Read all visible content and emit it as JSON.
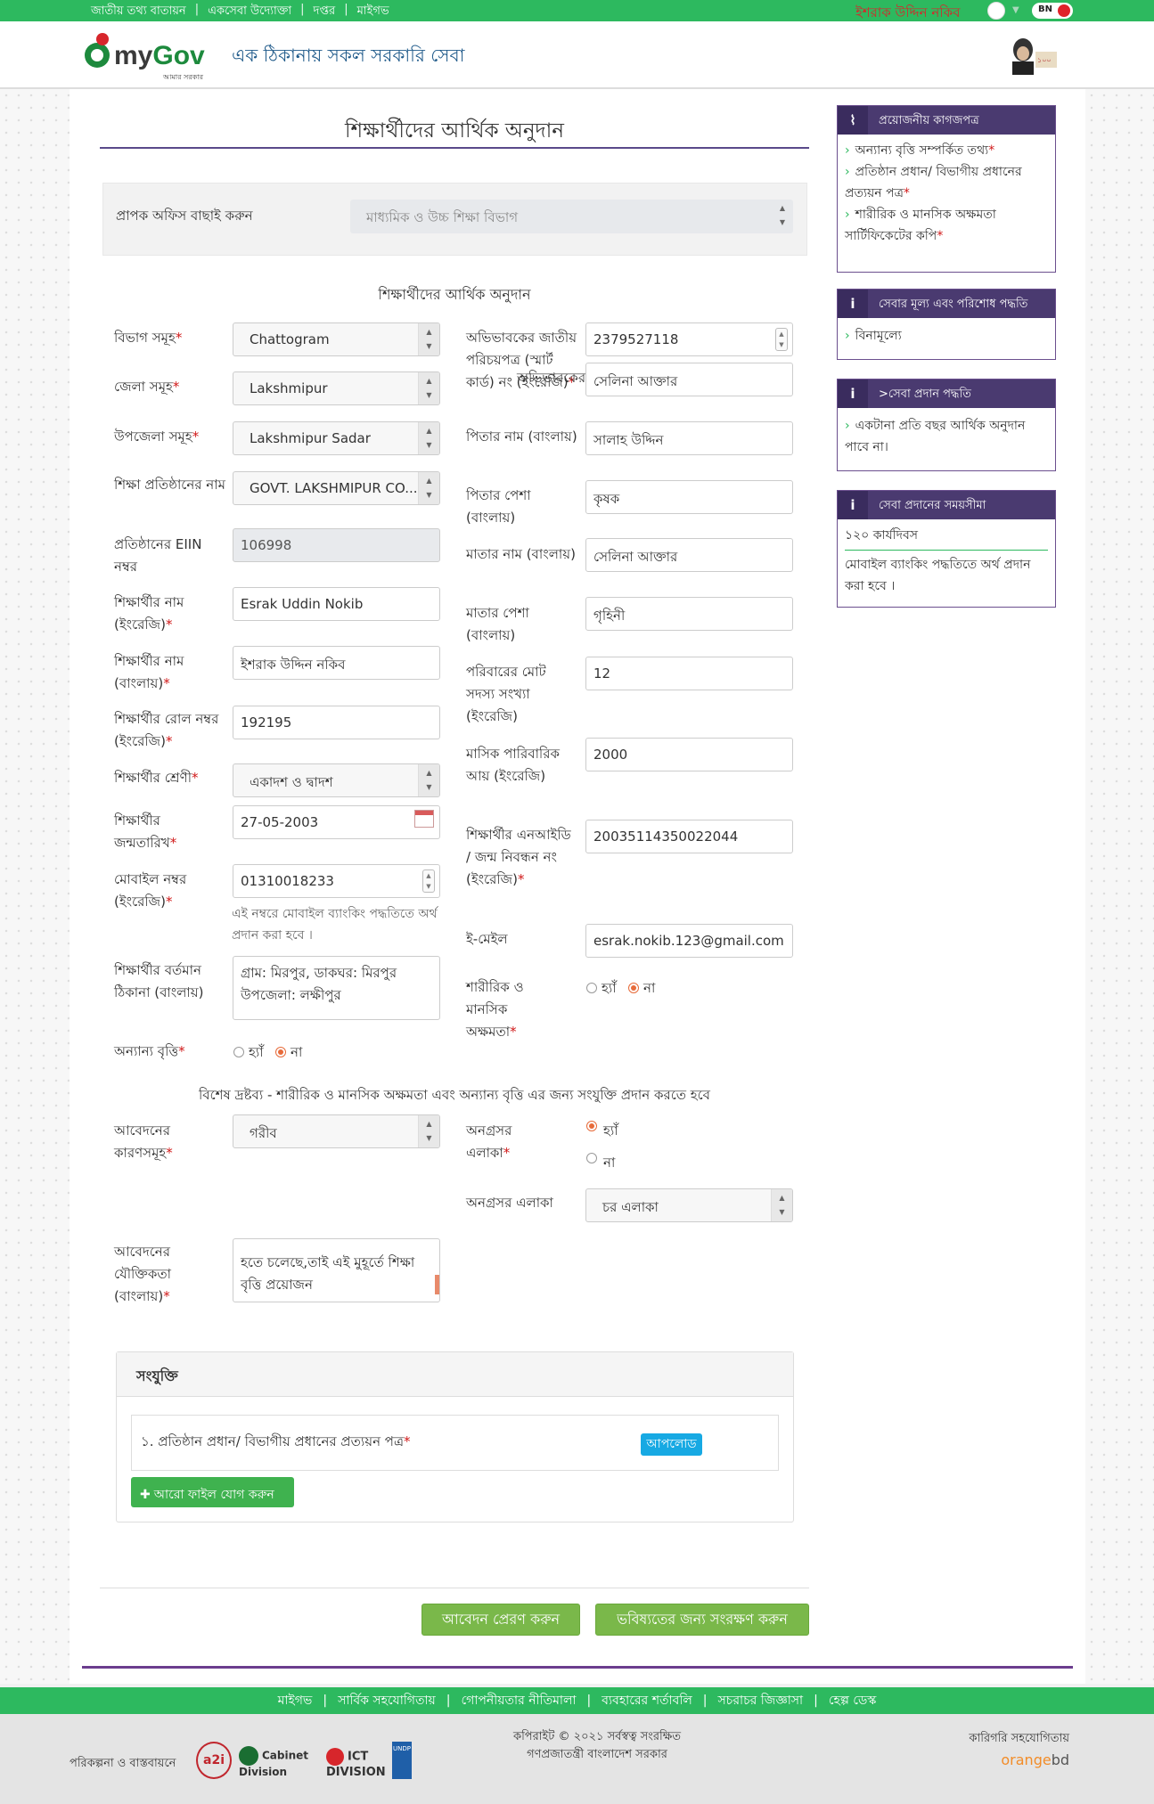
{
  "top_bar": {
    "links": [
      "জাতীয় তথ্য বাতায়ন",
      "একসেবা উদ্যোক্তা",
      "দপ্তর",
      "মাইগভ"
    ],
    "user_name": "ইশরাক উদ্দিন নকিব",
    "lang": "BN"
  },
  "header": {
    "logo_my": "my",
    "logo_gov": "Gov",
    "logo_sub": "আমার সরকার",
    "tagline": "এক ঠিকানায় সকল সরকারি সেবা"
  },
  "page": {
    "title": "শিক্ষার্থীদের আর্থিক অনুদান",
    "office_label": "প্রাপক অফিস বাছাই করুন",
    "office_value": "মাধ্যমিক ও উচ্চ শিক্ষা বিভাগ",
    "form_heading": "শিক্ষার্থীদের আর্থিক অনুদান"
  },
  "form": {
    "division": {
      "label": "বিভাগ সমূহ",
      "value": "Chattogram"
    },
    "district": {
      "label": "জেলা সমূহ",
      "value": "Lakshmipur"
    },
    "upazila": {
      "label": "উপজেলা সমূহ",
      "value": "Lakshmipur Sadar"
    },
    "institution": {
      "label": "শিক্ষা প্রতিষ্ঠানের নাম",
      "value": "GOVT. LAKSHMIPUR CO..."
    },
    "eiin": {
      "label": "প্রতিষ্ঠানের EIIN নম্বর",
      "value": "106998"
    },
    "student_name_en": {
      "label": "শিক্ষার্থীর নাম (ইংরেজি)",
      "value": "Esrak Uddin Nokib"
    },
    "student_name_bn": {
      "label": "শিক্ষার্থীর নাম (বাংলায়)",
      "value": "ইশরাক উদ্দিন নকিব"
    },
    "roll": {
      "label": "শিক্ষার্থীর রোল নম্বর (ইংরেজি)",
      "value": "192195"
    },
    "class": {
      "label": "শিক্ষার্থীর শ্রেণী",
      "value": "একাদশ ও দ্বাদশ"
    },
    "dob": {
      "label": "শিক্ষার্থীর জন্মতারিখ",
      "value": "27-05-2003"
    },
    "mobile": {
      "label": "মোবাইল নম্বর (ইংরেজি)",
      "value": "01310018233",
      "hint": "এই নম্বরে মোবাইল ব্যাংকিং পদ্ধতিতে অর্থ প্রদান করা হবে ।"
    },
    "address": {
      "label": "শিক্ষার্থীর বর্তমান ঠিকানা (বাংলায়)",
      "value_line1": "গ্রাম: মিরপুর, ডাকঘর: মিরপুর",
      "value_line2": "উপজেলা: লক্ষীপুর"
    },
    "other_stipend": {
      "label": "অন্যান্য বৃত্তি",
      "yes": "হ্যাঁ",
      "no": "না",
      "selected": "no"
    },
    "guardian_nid": {
      "label": "অভিভাবকের জাতীয় পরিচয়পত্র (স্মার্ট কার্ড) নং (ইংরেজি)",
      "value": "2379527118"
    },
    "guardian_name": {
      "label": "অভিভাবকের নাম (বাংলায়)",
      "value": "সেলিনা আক্তার"
    },
    "father_name": {
      "label": "পিতার নাম (বাংলায়)",
      "value": "সালাহ উদ্দিন"
    },
    "father_occupation": {
      "label": "পিতার পেশা (বাংলায়)",
      "value": "কৃষক"
    },
    "mother_name": {
      "label": "মাতার নাম (বাংলায়)",
      "value": "সেলিনা আক্তার"
    },
    "mother_occupation": {
      "label": "মাতার পেশা (বাংলায়)",
      "value": "গৃহিনী"
    },
    "family_members": {
      "label": "পরিবারের মোট সদস্য সংখ্যা (ইংরেজি)",
      "value": "12"
    },
    "monthly_income": {
      "label": "মাসিক পারিবারিক আয় (ইংরেজি)",
      "value": "2000"
    },
    "student_nid": {
      "label": "শিক্ষার্থীর এনআইডি / জন্ম নিবন্ধন নং (ইংরেজি)",
      "value": "20035114350022044"
    },
    "email": {
      "label": "ই-মেইল",
      "value": "esrak.nokib.123@gmail.com"
    },
    "disability": {
      "label": "শারীরিক ও মানসিক অক্ষমতা",
      "yes": "হ্যাঁ",
      "no": "না",
      "selected": "no"
    },
    "notice": "বিশেষ দ্রষ্টব্য - শারীরিক ও মানসিক অক্ষমতা এবং অন্যান্য বৃত্তি এর জন্য সংযুক্তি প্রদান করতে হবে",
    "reasons": {
      "label": "আবেদনের কারণসমূহ",
      "value": "গরীব"
    },
    "backward_area": {
      "label": "অনগ্রসর এলাকা",
      "yes": "হ্যাঁ",
      "no": "না",
      "selected": "yes"
    },
    "backward_area_type": {
      "label": "অনগ্রসর এলাকা",
      "value": "চর এলাকা"
    },
    "justification": {
      "label": "আবেদনের যৌক্তিকতা (বাংলায়)",
      "value_line1": "হতে চলেছে,তাই এই মুহূর্তে শিক্ষা",
      "value_line2": "বৃত্তি প্রয়োজন"
    }
  },
  "attachments": {
    "title": "সংযুক্তি",
    "items": [
      {
        "label": "১. প্রতিষ্ঠান প্রধান/ বিভাগীয় প্রধানের প্রত্যয়ন পত্র",
        "button": "আপলোড"
      }
    ],
    "add_more": "আরো ফাইল যোগ করুন"
  },
  "actions": {
    "submit": "আবেদন প্রেরণ করুন",
    "save_later": "ভবিষ্যতের জন্য সংরক্ষণ করুন"
  },
  "sidebar": {
    "documents": {
      "title": "প্রয়োজনীয় কাগজপত্র",
      "items": [
        "অন্যান্য বৃত্তি সম্পর্কিত তথ্য",
        "প্রতিষ্ঠান প্রধান/ বিভাগীয় প্রধানের প্রত্যয়ন পত্র",
        "শারীরিক ও মানসিক অক্ষমতা সার্টিফিকেটের কপি"
      ]
    },
    "fee": {
      "title": "সেবার মূল্য এবং পরিশোধ পদ্ধতি",
      "item": "বিনামূল্যে"
    },
    "method": {
      "title": ">সেবা প্রদান পদ্ধতি",
      "item": "একটানা প্রতি বছর আর্থিক অনুদান পাবে না।"
    },
    "time": {
      "title": "সেবা প্রদানের সময়সীমা",
      "line1": "১২০ কার্যদিবস",
      "line2": "মোবাইল ব্যাংকিং পদ্ধতিতে অর্থ প্রদান করা হবে ।"
    }
  },
  "footer": {
    "links": [
      "মাইগভ",
      "সার্বিক সহযোগিতায়",
      "গোপনীয়তার নীতিমালা",
      "ব্যবহারের শর্তাবলি",
      "সচরাচর জিজ্ঞাসা",
      "হেল্প ডেস্ক"
    ],
    "plan": "পরিকল্পনা ও বাস্তবায়নে",
    "logo_a2i": "a2i",
    "logo_cabinet": "Cabinet Division",
    "logo_ict": "ICT DIVISION",
    "logo_undp": "UNDP",
    "copyright_line1": "কপিরাইট © ২০২১ সর্বস্বত্ব সংরক্ষিত",
    "copyright_line2": "গণপ্রজাতন্ত্রী বাংলাদেশ সরকার",
    "tech": "কারিগরি সহযোগিতায়",
    "orange": "orange",
    "bd": "bd"
  }
}
